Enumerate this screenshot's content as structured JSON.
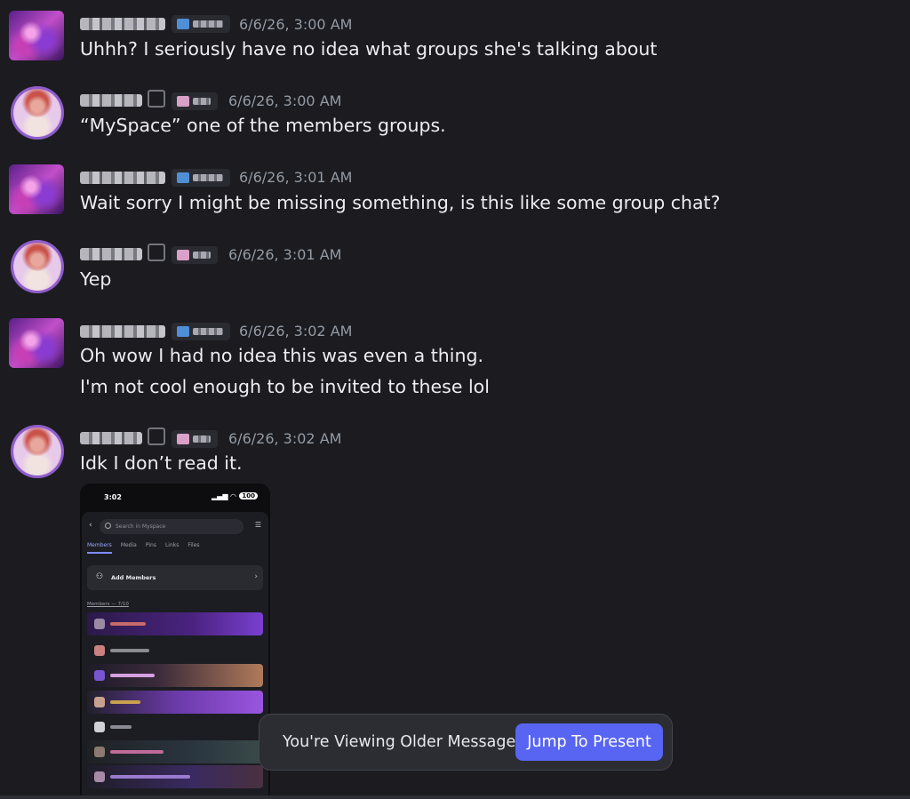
{
  "messages": [
    {
      "timestamp": "6/6/26, 3:00 AM",
      "lines": [
        "Uhhh? I seriously have no idea what groups she's talking about"
      ]
    },
    {
      "timestamp": "6/6/26, 3:00 AM",
      "lines": [
        "“MySpace” one of the members groups."
      ]
    },
    {
      "timestamp": "6/6/26, 3:01 AM",
      "lines": [
        "Wait sorry I might be missing something, is this like some group chat?"
      ]
    },
    {
      "timestamp": "6/6/26, 3:01 AM",
      "lines": [
        "Yep"
      ]
    },
    {
      "timestamp": "6/6/26, 3:02 AM",
      "lines": [
        "Oh wow I had no idea this was even a thing.",
        "I'm not cool enough to be invited to these lol"
      ]
    },
    {
      "timestamp": "6/6/26, 3:02 AM",
      "lines": [
        "Idk I don’t read it."
      ]
    }
  ],
  "attachment": {
    "status_time": "3:02",
    "battery": "100",
    "search_placeholder": "Search in Myspace",
    "tabs": [
      "Members",
      "Media",
      "Pins",
      "Links",
      "Files"
    ],
    "add_members_label": "Add Members",
    "members_count": "Members — 7/10"
  },
  "banner": {
    "text": "You're Viewing Older Messages",
    "button_label": "Jump To Present"
  },
  "colors": {
    "background": "#1b1b20",
    "accent": "#5865f2",
    "timestamp": "#949ba4"
  }
}
